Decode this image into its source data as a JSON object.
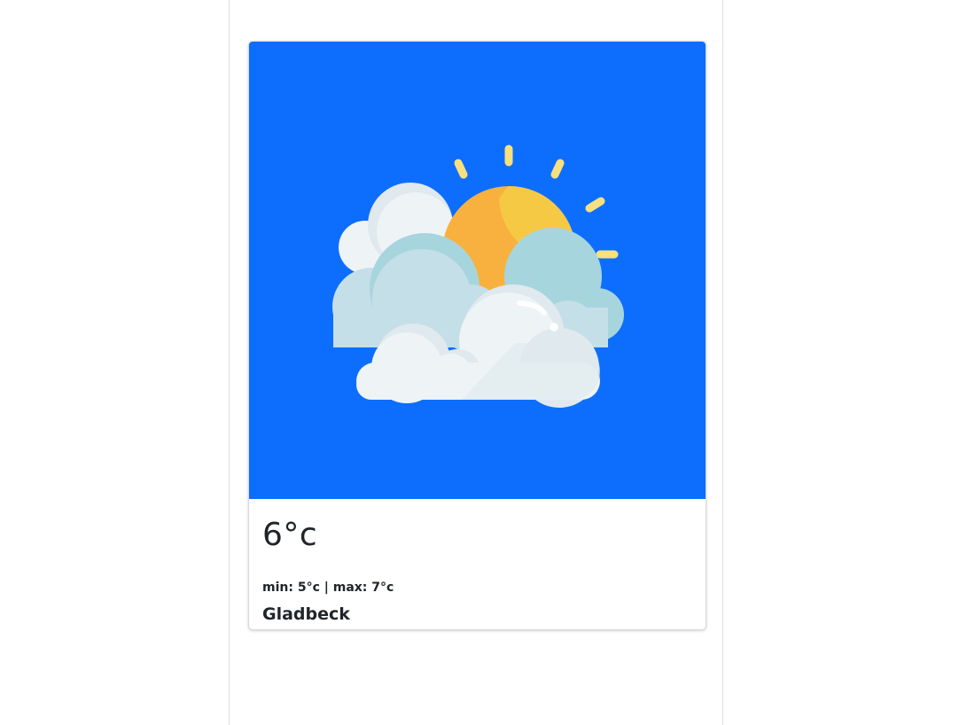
{
  "weather_card": {
    "icon": "partly-cloudy-icon",
    "image_background": "#0d6efd",
    "temperature": "6°c",
    "min_max": "min: 5°c | max: 7°c",
    "city": "Gladbeck"
  },
  "colors": {
    "sun": "#f8b13e",
    "sun_highlight": "#f6c945",
    "sun_rays": "#f7e07d",
    "cloud_light": "#eef3f6",
    "cloud_mid": "#c4dfe7",
    "cloud_dark": "#a7d5de",
    "text": "#212529"
  }
}
